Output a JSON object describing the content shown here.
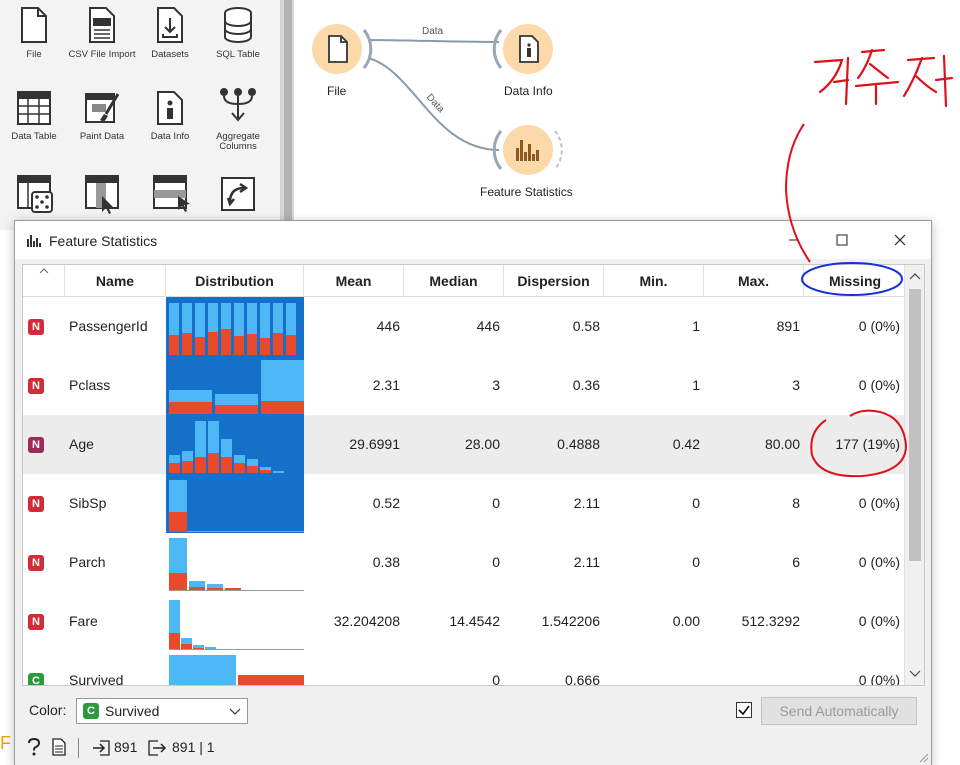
{
  "toolbox": {
    "widgets": [
      {
        "label": "File",
        "icon": "file-icon"
      },
      {
        "label": "CSV File Import",
        "icon": "csv-file-icon"
      },
      {
        "label": "Datasets",
        "icon": "datasets-icon"
      },
      {
        "label": "SQL Table",
        "icon": "sql-table-icon"
      },
      {
        "label": "Data Table",
        "icon": "data-table-icon"
      },
      {
        "label": "Paint Data",
        "icon": "paint-data-icon"
      },
      {
        "label": "Data Info",
        "icon": "data-info-icon"
      },
      {
        "label": "Aggregate Columns",
        "icon": "aggregate-columns-icon"
      }
    ]
  },
  "canvas": {
    "nodes": {
      "file": "File",
      "data_info": "Data Info",
      "feature_statistics": "Feature Statistics"
    },
    "link_labels": {
      "file_to_info": "Data",
      "file_to_stats": "Data"
    }
  },
  "dialog": {
    "title": "Feature Statistics",
    "columns": [
      "Name",
      "Distribution",
      "Mean",
      "Median",
      "Dispersion",
      "Min.",
      "Max.",
      "Missing"
    ],
    "rows": [
      {
        "type": "N",
        "name": "PassengerId",
        "mean": "446",
        "median": "446",
        "dispersion": "0.58",
        "min": "1",
        "max": "891",
        "missing": "0 (0%)"
      },
      {
        "type": "N",
        "name": "Pclass",
        "mean": "2.31",
        "median": "3",
        "dispersion": "0.36",
        "min": "1",
        "max": "3",
        "missing": "0 (0%)"
      },
      {
        "type": "N",
        "name": "Age",
        "mean": "29.6991",
        "median": "28.00",
        "dispersion": "0.4888",
        "min": "0.42",
        "max": "80.00",
        "missing": "177 (19%)"
      },
      {
        "type": "N",
        "name": "SibSp",
        "mean": "0.52",
        "median": "0",
        "dispersion": "2.11",
        "min": "0",
        "max": "8",
        "missing": "0 (0%)"
      },
      {
        "type": "N",
        "name": "Parch",
        "mean": "0.38",
        "median": "0",
        "dispersion": "2.11",
        "min": "0",
        "max": "6",
        "missing": "0 (0%)"
      },
      {
        "type": "N",
        "name": "Fare",
        "mean": "32.204208",
        "median": "14.4542",
        "dispersion": "1.542206",
        "min": "0.00",
        "max": "512.3292",
        "missing": "0 (0%)"
      },
      {
        "type": "C",
        "name": "Survived",
        "mean": "",
        "median": "0",
        "dispersion": "0.666",
        "min": "",
        "max": "",
        "missing": "0 (0%)"
      }
    ],
    "footer": {
      "color_label": "Color:",
      "color_badge": "C",
      "color_value": "Survived",
      "send_button": "Send Automatically",
      "send_auto_checked": true
    },
    "status": {
      "input_count": "891",
      "output_count": "891 | 1"
    }
  },
  "colors": {
    "numeric_badge": "#d42b3a",
    "categorical_badge": "#2a9a3a",
    "bar_blue": "#4db8f5",
    "bar_red": "#ea4a2c",
    "selected_fill": "#1470c8",
    "node_fill": "#fcd9a8"
  },
  "side_dock_glyph": "F"
}
